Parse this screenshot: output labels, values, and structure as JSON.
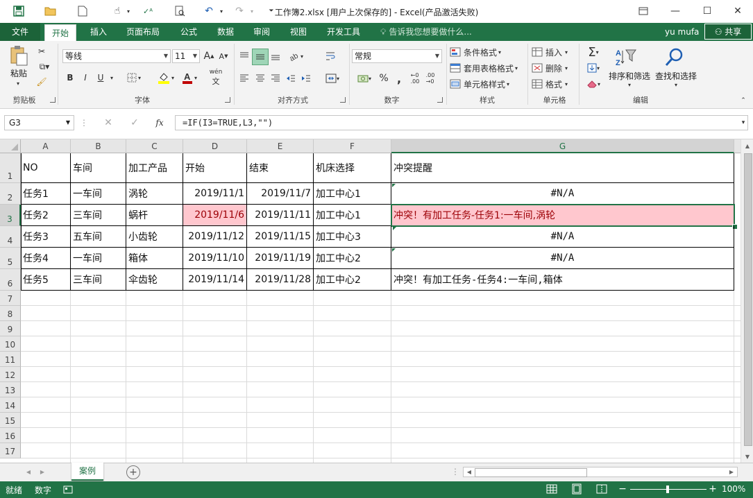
{
  "titlebar": {
    "title": "工作簿2.xlsx  [用户上次保存的]  -  Excel(产品激活失败)"
  },
  "tabs": {
    "file": "文件",
    "items": [
      "开始",
      "插入",
      "页面布局",
      "公式",
      "数据",
      "审阅",
      "视图",
      "开发工具"
    ],
    "tell_me": "告诉我您想要做什么...",
    "user": "yu mufa",
    "share": "共享"
  },
  "ribbon": {
    "clipboard": {
      "paste": "粘贴",
      "label": "剪贴板"
    },
    "font": {
      "name": "等线",
      "size": "11",
      "label": "字体",
      "bold": "B",
      "italic": "I",
      "underline": "U",
      "grow": "A",
      "shrink": "A",
      "wen": "wén"
    },
    "alignment": {
      "label": "对齐方式"
    },
    "number": {
      "format": "常规",
      "label": "数字",
      "percent": "%",
      "comma": ","
    },
    "styles": {
      "cond": "条件格式",
      "table": "套用表格格式",
      "cell": "单元格样式",
      "label": "样式"
    },
    "cells": {
      "insert": "插入",
      "delete": "删除",
      "format": "格式",
      "label": "单元格"
    },
    "editing": {
      "sort": "排序和筛选",
      "find": "查找和选择",
      "label": "编辑"
    }
  },
  "formula_bar": {
    "name_box": "G3",
    "fx": "fx",
    "formula": "=IF(I3=TRUE,L3,\"\")"
  },
  "grid": {
    "columns": [
      "A",
      "B",
      "C",
      "D",
      "E",
      "F",
      "G"
    ],
    "rows": [
      "1",
      "2",
      "3",
      "4",
      "5",
      "6",
      "7",
      "8",
      "9",
      "10",
      "11",
      "12",
      "13",
      "14",
      "15",
      "16",
      "17"
    ],
    "data": [
      [
        "NO",
        "车间",
        "加工产品",
        "开始",
        "结束",
        "机床选择",
        "冲突提醒"
      ],
      [
        "任务1",
        "一车间",
        "涡轮",
        "2019/11/1",
        "2019/11/7",
        "加工中心1",
        "#N/A"
      ],
      [
        "任务2",
        "三车间",
        "蜗杆",
        "2019/11/6",
        "2019/11/11",
        "加工中心1",
        "冲突！有加工任务-任务1:一车间,涡轮"
      ],
      [
        "任务3",
        "五车间",
        "小齿轮",
        "2019/11/12",
        "2019/11/15",
        "加工中心3",
        "#N/A"
      ],
      [
        "任务4",
        "一车间",
        "箱体",
        "2019/11/10",
        "2019/11/19",
        "加工中心2",
        "#N/A"
      ],
      [
        "任务5",
        "三车间",
        "伞齿轮",
        "2019/11/14",
        "2019/11/28",
        "加工中心2",
        "冲突！有加工任务-任务4:一车间,箱体"
      ]
    ],
    "highlight_color": "#ffc7ce",
    "highlight_text": "#9c0006"
  },
  "sheets": {
    "active": "案例"
  },
  "status": {
    "ready": "就绪",
    "mode": "数字",
    "zoom": "100%"
  },
  "colors": {
    "accent": "#217346"
  }
}
